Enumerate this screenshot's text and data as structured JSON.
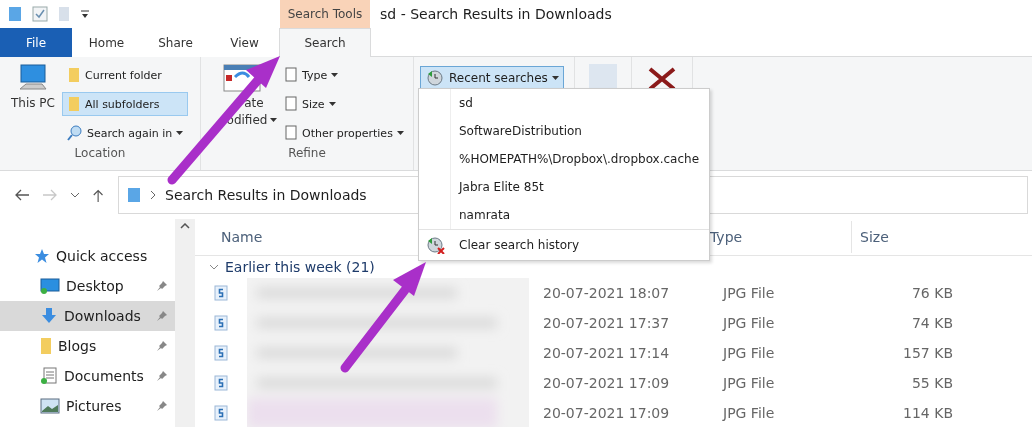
{
  "contextual_tab": {
    "label": "Search Tools"
  },
  "window": {
    "title": "sd - Search Results in Downloads"
  },
  "tabs": [
    {
      "label": "File",
      "kind": "file",
      "selected": false
    },
    {
      "label": "Home",
      "kind": "tab",
      "selected": false
    },
    {
      "label": "Share",
      "kind": "tab",
      "selected": false
    },
    {
      "label": "View",
      "kind": "tab",
      "selected": false
    },
    {
      "label": "Search",
      "kind": "tab",
      "selected": true
    }
  ],
  "location": {
    "label": "Location",
    "this_pc": "This PC",
    "scopes": [
      {
        "label": "Current folder",
        "selected": false
      },
      {
        "label": "All subfolders",
        "selected": true
      }
    ],
    "search_again": "Search again in"
  },
  "refine": {
    "label": "Refine",
    "date_lines": [
      "ate",
      "odified"
    ],
    "buttons": [
      "Type",
      "Size",
      "Other properties"
    ]
  },
  "recent_searches": {
    "label": "Recent searches",
    "expanded": true
  },
  "recent_menu": {
    "items": [
      "sd",
      "SoftwareDistribution",
      "%HOMEPATH%\\Dropbox\\.dropbox.cache",
      "Jabra Elite 85t",
      "namrata"
    ],
    "clear": "Clear search history"
  },
  "address": {
    "path": "Search Results in Downloads"
  },
  "nav": {
    "items": [
      {
        "label": "Quick access",
        "kind": "star",
        "pinned": false,
        "selected": false
      },
      {
        "label": "Desktop",
        "kind": "desktop",
        "pinned": true,
        "selected": false
      },
      {
        "label": "Downloads",
        "kind": "download",
        "pinned": true,
        "selected": true
      },
      {
        "label": "Blogs",
        "kind": "folder",
        "pinned": true,
        "selected": false
      },
      {
        "label": "Documents",
        "kind": "documents",
        "pinned": true,
        "selected": false
      },
      {
        "label": "Pictures",
        "kind": "pictures",
        "pinned": true,
        "selected": false
      }
    ]
  },
  "columns": {
    "name": "Name",
    "type": "Type",
    "size": "Size"
  },
  "group": {
    "label": "Earlier this week (21)",
    "expanded": true
  },
  "rows": [
    {
      "date": "20-07-2021 18:07",
      "type": "JPG File",
      "size": "76 KB"
    },
    {
      "date": "20-07-2021 17:37",
      "type": "JPG File",
      "size": "74 KB"
    },
    {
      "date": "20-07-2021 17:14",
      "type": "JPG File",
      "size": "157 KB"
    },
    {
      "date": "20-07-2021 17:09",
      "type": "JPG File",
      "size": "55 KB"
    },
    {
      "date": "20-07-2021 17:09",
      "type": "JPG File",
      "size": "114 KB"
    }
  ]
}
